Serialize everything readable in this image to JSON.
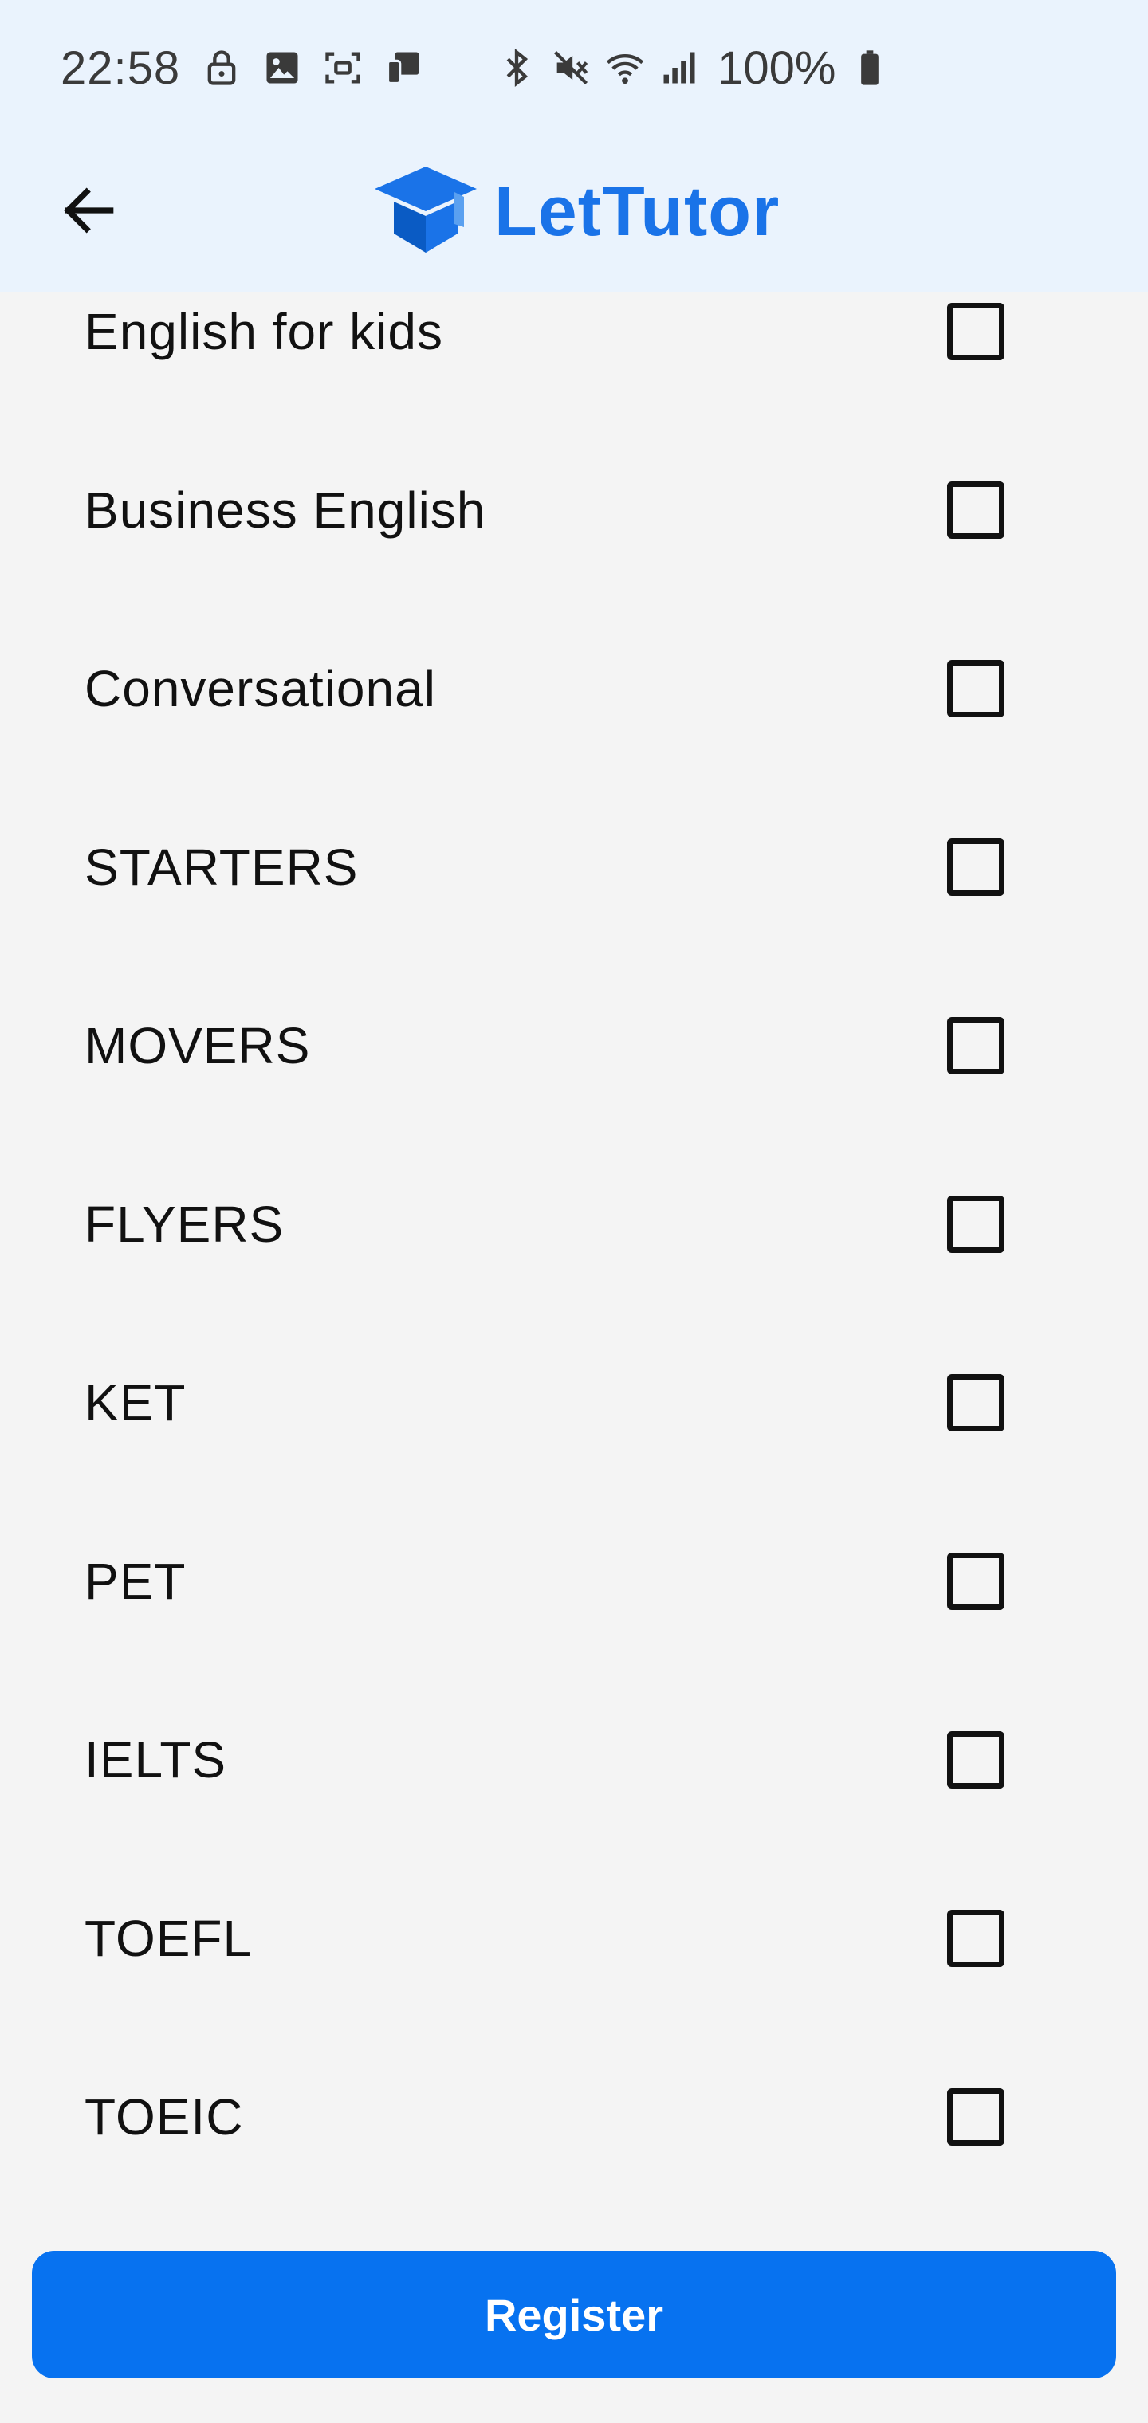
{
  "status_bar": {
    "time": "22:58",
    "battery_text": "100%",
    "left_icons": [
      "lock-icon",
      "image-icon",
      "screenshot-icon",
      "cast-icon"
    ],
    "right_icons": [
      "bluetooth-icon",
      "mute-icon",
      "wifi-icon",
      "signal-icon",
      "battery-icon"
    ]
  },
  "appbar": {
    "back_icon": "arrow-left-icon",
    "logo_icon": "graduation-cap-icon",
    "logo_text": "LetTutor"
  },
  "specialties": [
    {
      "label": "English for kids",
      "checked": false
    },
    {
      "label": "Business English",
      "checked": false
    },
    {
      "label": "Conversational",
      "checked": false
    },
    {
      "label": "STARTERS",
      "checked": false
    },
    {
      "label": "MOVERS",
      "checked": false
    },
    {
      "label": "FLYERS",
      "checked": false
    },
    {
      "label": "KET",
      "checked": false
    },
    {
      "label": "PET",
      "checked": false
    },
    {
      "label": "IELTS",
      "checked": false
    },
    {
      "label": "TOEFL",
      "checked": false
    },
    {
      "label": "TOEIC",
      "checked": false
    }
  ],
  "register_button": {
    "label": "Register"
  },
  "colors": {
    "brand": "#1a73e8",
    "button": "#0772f0",
    "header_bg": "#eaf3fd",
    "page_bg": "#f4f4f4"
  }
}
